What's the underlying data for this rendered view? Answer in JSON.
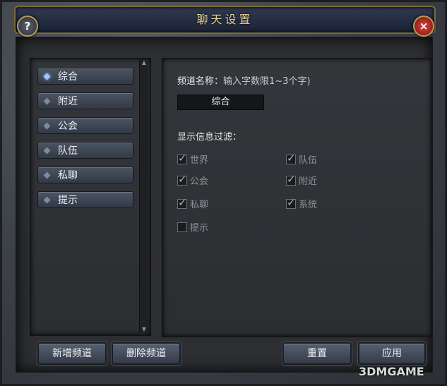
{
  "window": {
    "title": "聊天设置",
    "help_symbol": "?",
    "close_symbol": "×"
  },
  "channels": [
    {
      "label": "综合",
      "selected": true
    },
    {
      "label": "附近",
      "selected": false
    },
    {
      "label": "公会",
      "selected": false
    },
    {
      "label": "队伍",
      "selected": false
    },
    {
      "label": "私聊",
      "selected": false
    },
    {
      "label": "提示",
      "selected": false
    }
  ],
  "settings": {
    "name_label": "频道名称：",
    "name_hint": "输入字数限1~3个字)",
    "name_value": "综合",
    "filter_label": "显示信息过滤：",
    "filters": [
      {
        "label": "世界",
        "checked": true
      },
      {
        "label": "队伍",
        "checked": true
      },
      {
        "label": "公会",
        "checked": true
      },
      {
        "label": "附近",
        "checked": true
      },
      {
        "label": "私聊",
        "checked": true
      },
      {
        "label": "系统",
        "checked": true
      },
      {
        "label": "提示",
        "checked": false
      }
    ]
  },
  "buttons": {
    "add": "新增频道",
    "delete": "删除频道",
    "reset": "重置",
    "apply": "应用"
  },
  "watermark": "3DMGAME"
}
